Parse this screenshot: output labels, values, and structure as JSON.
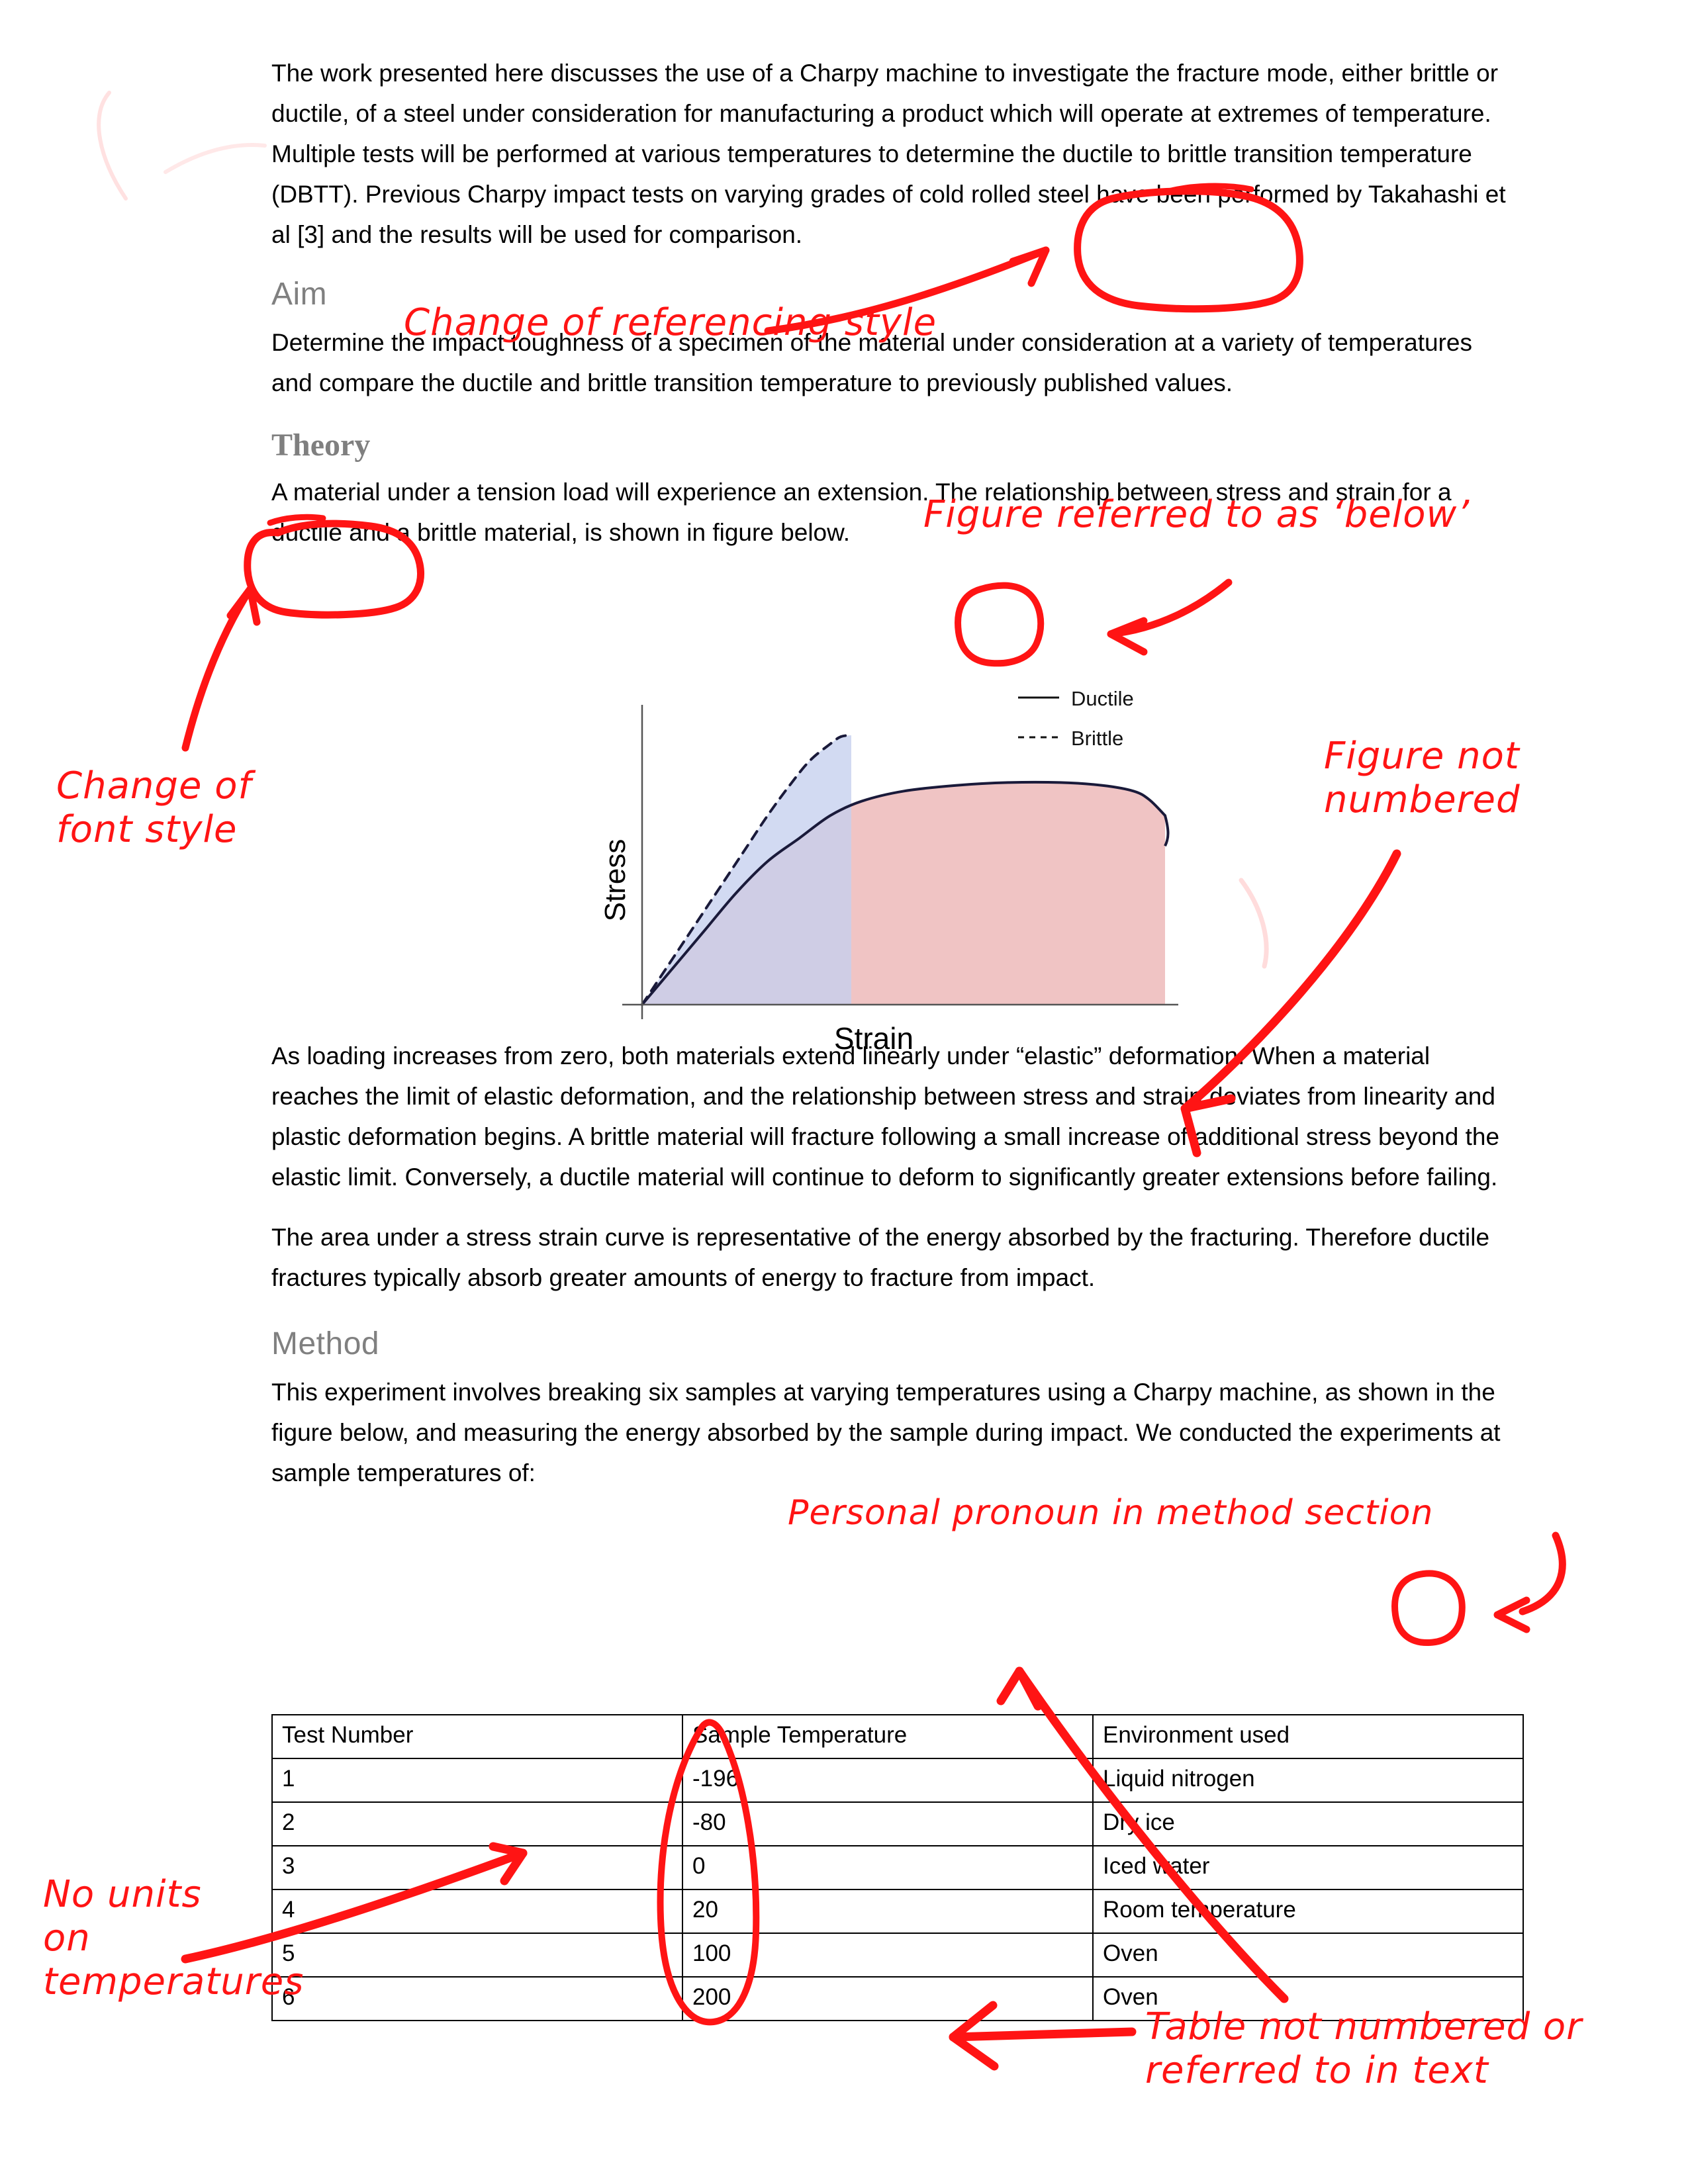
{
  "document": {
    "paragraphs": {
      "intro": "The work presented here discusses the use of a Charpy machine to investigate the fracture mode, either brittle or ductile, of a steel under consideration for manufacturing a product which will operate at extremes of temperature. Multiple tests will be performed at various temperatures to determine the ductile to brittle transition temperature (DBTT). Previous Charpy impact tests on varying grades of cold rolled steel have been performed by Takahashi et al [3] and the results will be used for comparison.",
      "aim_body": "Determine the impact toughness of a specimen of the material under consideration at a variety of temperatures and compare the ductile and brittle transition temperature to previously published values.",
      "theory_body": "A material under a tension load will experience an extension. The relationship between stress and strain for a ductile and a brittle material, is shown in figure below.",
      "after_figure_1": "As loading increases from zero, both materials extend linearly under “elastic” deformation. When a material reaches the limit of elastic deformation, and the relationship between stress and strain deviates from linearity and plastic deformation begins. A brittle material will fracture following a small increase of additional stress beyond the elastic limit. Conversely, a ductile material will continue to deform to significantly greater extensions before failing.",
      "after_figure_2": "The area under a stress strain curve is representative of the energy absorbed by the fracturing. Therefore ductile fractures typically absorb greater amounts of energy to fracture from impact.",
      "method_body": "This experiment involves breaking six samples at varying temperatures using a Charpy machine, as shown in the figure below, and measuring the energy absorbed by the sample during impact. We conducted the experiments at sample temperatures of:"
    },
    "headings": {
      "aim": "Aim",
      "theory": "Theory",
      "method": "Method"
    },
    "heading_color_grey": "#808080"
  },
  "chart_data": {
    "type": "line",
    "title": "",
    "xlabel": "Strain",
    "ylabel": "Stress",
    "grid": false,
    "legend_position": "top-right",
    "series": [
      {
        "name": "Ductile",
        "linestyle": "solid",
        "color": "#1a1a3a",
        "fill_color": "#f0c4c4",
        "x": [
          0,
          0.06,
          0.12,
          0.18,
          0.24,
          0.3,
          0.36,
          0.42,
          0.5,
          0.6,
          0.7,
          0.8,
          0.88,
          0.94,
          0.97,
          1.0
        ],
        "y": [
          0,
          0.13,
          0.26,
          0.39,
          0.5,
          0.58,
          0.66,
          0.71,
          0.745,
          0.765,
          0.775,
          0.775,
          0.765,
          0.745,
          0.715,
          0.66
        ]
      },
      {
        "name": "Brittle",
        "linestyle": "dashed",
        "color": "#1a1a3a",
        "fill_color": "#c5cfee",
        "x": [
          0,
          0.04,
          0.08,
          0.12,
          0.16,
          0.2,
          0.24,
          0.28,
          0.32,
          0.36,
          0.38,
          0.4
        ],
        "y": [
          0,
          0.11,
          0.22,
          0.33,
          0.44,
          0.55,
          0.66,
          0.76,
          0.85,
          0.91,
          0.935,
          0.94
        ]
      }
    ],
    "legend": [
      "Ductile",
      "Brittle"
    ],
    "overlap_fill_color": "#b59cc8",
    "axis_color": "#404040"
  },
  "table": {
    "headers": [
      "Test Number",
      "Sample Temperature",
      "Environment used"
    ],
    "rows": [
      [
        "1",
        "-196",
        "Liquid nitrogen"
      ],
      [
        "2",
        "-80",
        "Dry ice"
      ],
      [
        "3",
        "0",
        "Iced water"
      ],
      [
        "4",
        "20",
        "Room temperature"
      ],
      [
        "5",
        "100",
        "Oven"
      ],
      [
        "6",
        "200",
        "Oven"
      ]
    ]
  },
  "annotations": {
    "color": "#ff1414",
    "items": [
      {
        "id": "referencing-style",
        "text": "Change of referencing style"
      },
      {
        "id": "figure-referred-below",
        "text": "Figure referred to as ‘below’"
      },
      {
        "id": "change-of-font-style",
        "text": "Change of\nfont style"
      },
      {
        "id": "figure-not-numbered",
        "text": "Figure not\nnumbered"
      },
      {
        "id": "personal-pronoun",
        "text": "Personal pronoun in method section"
      },
      {
        "id": "no-units",
        "text": "No units\non\ntemperatures"
      },
      {
        "id": "table-not-numbered",
        "text": "Table not numbered or\nreferred to in text"
      }
    ]
  }
}
